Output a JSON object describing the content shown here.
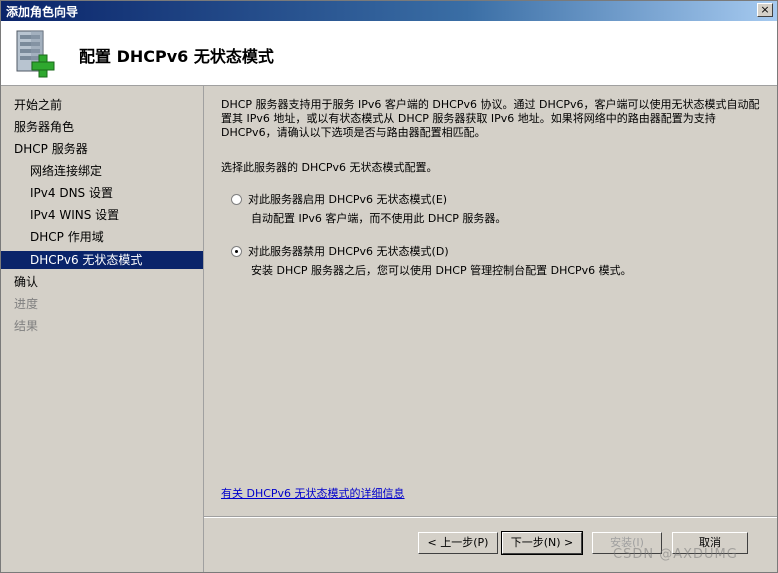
{
  "window": {
    "title": "添加角色向导",
    "close_glyph": "×"
  },
  "header": {
    "title": "配置 DHCPv6 无状态模式"
  },
  "nav": {
    "items": [
      {
        "label": "开始之前"
      },
      {
        "label": "服务器角色"
      },
      {
        "label": "DHCP 服务器"
      },
      {
        "label": "网络连接绑定"
      },
      {
        "label": "IPv4 DNS 设置"
      },
      {
        "label": "IPv4 WINS 设置"
      },
      {
        "label": "DHCP 作用域"
      },
      {
        "label": "DHCPv6 无状态模式"
      },
      {
        "label": "确认"
      },
      {
        "label": "进度"
      },
      {
        "label": "结果"
      }
    ]
  },
  "content": {
    "description": "DHCP 服务器支持用于服务 IPv6 客户端的 DHCPv6 协议。通过 DHCPv6，客户端可以使用无状态模式自动配置其 IPv6 地址，或以有状态模式从 DHCP 服务器获取 IPv6 地址。如果将网络中的路由器配置为支持 DHCPv6，请确认以下选项是否与路由器配置相匹配。",
    "prompt": "选择此服务器的 DHCPv6 无状态模式配置。",
    "options": [
      {
        "label": "对此服务器启用 DHCPv6 无状态模式(E)",
        "desc": "自动配置 IPv6 客户端，而不使用此 DHCP 服务器。",
        "checked": false
      },
      {
        "label": "对此服务器禁用 DHCPv6 无状态模式(D)",
        "desc": "安装 DHCP 服务器之后，您可以使用 DHCP 管理控制台配置 DHCPv6 模式。",
        "checked": true
      }
    ],
    "info_link": "有关 DHCPv6 无状态模式的详细信息"
  },
  "buttons": {
    "back": "< 上一步(P)",
    "next": "下一步(N) >",
    "install": "安装(I)",
    "cancel": "取消"
  },
  "watermark": "CSDN @AXDUMG"
}
